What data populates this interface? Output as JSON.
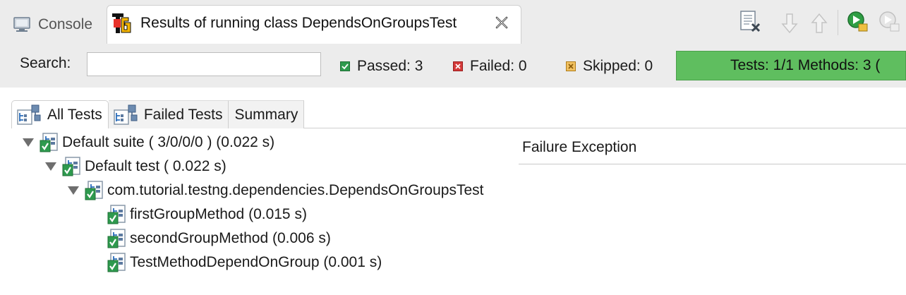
{
  "tabs": {
    "console_label": "Console",
    "results_label": "Results of running class DependsOnGroupsTest"
  },
  "filter": {
    "search_label": "Search:",
    "search_value": "",
    "passed_label": "Passed: 3",
    "failed_label": "Failed: 0",
    "skipped_label": "Skipped: 0",
    "progress_text": "Tests: 1/1  Methods: 3 (",
    "progress_fraction": 1.0
  },
  "subtabs": {
    "all_tests": "All Tests",
    "failed_tests": "Failed Tests",
    "summary": "Summary"
  },
  "tree": {
    "suite": "Default suite ( 3/0/0/0 ) (0.022 s)",
    "test": "Default test ( 0.022 s)",
    "class": "com.tutorial.testng.dependencies.DependsOnGroupsTest",
    "methods": [
      "firstGroupMethod  (0.015 s)",
      "secondGroupMethod  (0.006 s)",
      "TestMethodDependOnGroup  (0.001 s)"
    ]
  },
  "failure_panel": {
    "title": "Failure Exception"
  },
  "colors": {
    "progress_green": "#5fbe5f",
    "passed_green": "#2e9a4e",
    "failed_red": "#d43a3a",
    "skipped_orange": "#e0a030"
  }
}
